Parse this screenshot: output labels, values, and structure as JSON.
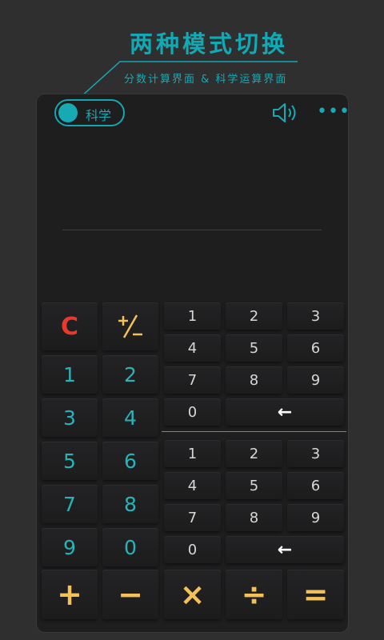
{
  "promo": {
    "title": "两种模式切换",
    "subtitle": "分数计算界面 & 科学运算界面",
    "accent": "#12a8b4"
  },
  "header": {
    "mode_label": "科学",
    "sound_icon": "speaker-icon",
    "more_icon": "more-dots-icon",
    "more_glyph": "•••"
  },
  "left_keypad": {
    "clear": "C",
    "sign_glyph": "+/−",
    "digits": [
      "1",
      "2",
      "3",
      "4",
      "5",
      "6",
      "7",
      "8",
      "9",
      "0"
    ]
  },
  "numerator_pad": {
    "digits": [
      "1",
      "2",
      "3",
      "4",
      "5",
      "6",
      "7",
      "8",
      "9",
      "0"
    ],
    "backspace": "←"
  },
  "denominator_pad": {
    "digits": [
      "1",
      "2",
      "3",
      "4",
      "5",
      "6",
      "7",
      "8",
      "9",
      "0"
    ],
    "backspace": "←"
  },
  "operators": {
    "add": "+",
    "subtract": "−",
    "multiply": "×",
    "divide": "÷",
    "equals": "="
  },
  "colors": {
    "teal": "#17a9b4",
    "clear_red": "#e8392f",
    "operator_yellow": "#f3c05a",
    "key_bg": "#202021"
  }
}
